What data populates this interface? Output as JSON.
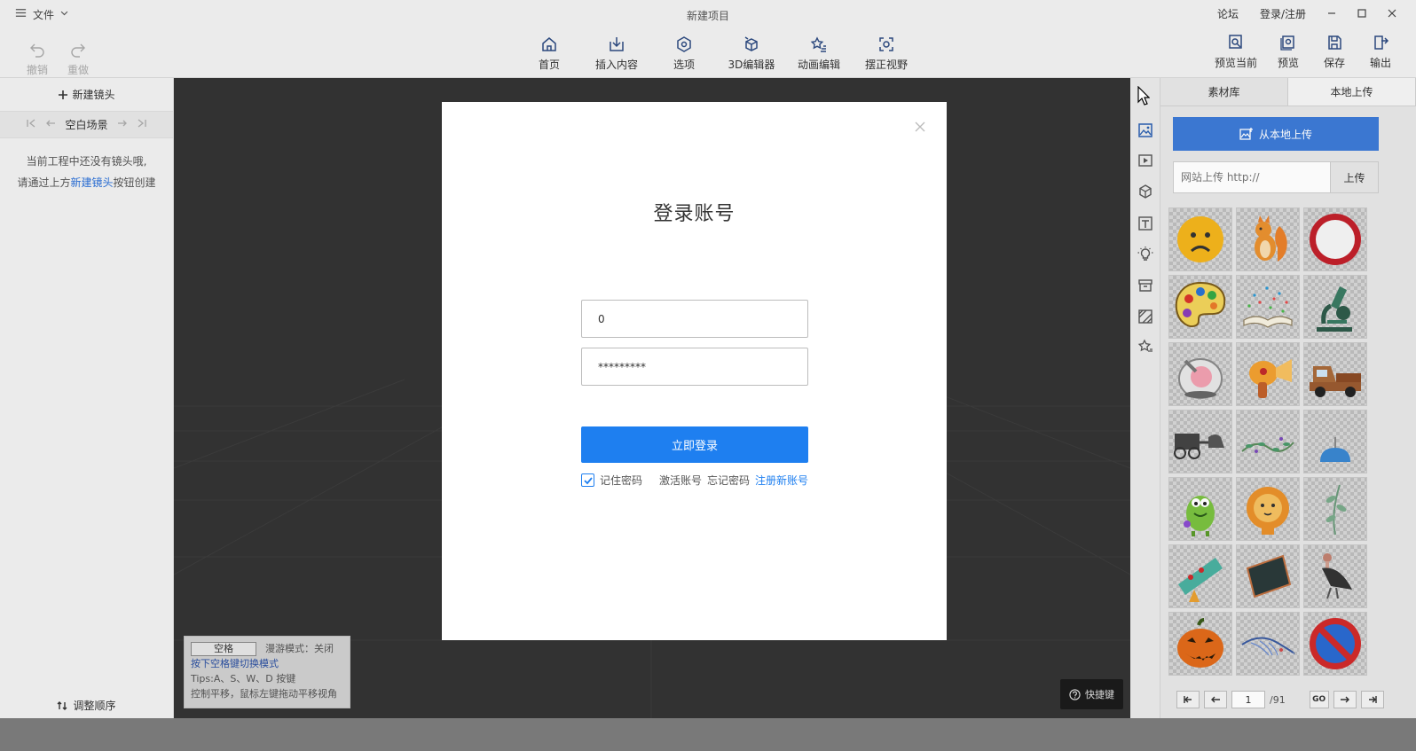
{
  "app": {
    "title": "新建项目",
    "file_menu": "文件",
    "forum": "论坛",
    "login_register": "登录/注册"
  },
  "toolbar": {
    "undo": "撤销",
    "redo": "重做",
    "center": [
      {
        "label": "首页",
        "icon": "home-icon"
      },
      {
        "label": "插入内容",
        "icon": "insert-icon"
      },
      {
        "label": "选项",
        "icon": "options-icon"
      },
      {
        "label": "3D编辑器",
        "icon": "cube-editor-icon"
      },
      {
        "label": "动画编辑",
        "icon": "animation-icon"
      },
      {
        "label": "摆正视野",
        "icon": "reset-view-icon"
      }
    ],
    "right": [
      {
        "label": "预览当前",
        "icon": "preview-current-icon"
      },
      {
        "label": "预览",
        "icon": "preview-icon"
      },
      {
        "label": "保存",
        "icon": "save-icon"
      },
      {
        "label": "输出",
        "icon": "export-icon"
      }
    ]
  },
  "left_panel": {
    "new_shot": "新建镜头",
    "scene_label": "空白场景",
    "empty_line1": "当前工程中还没有镜头哦,",
    "empty_line2_pre": "请通过上方",
    "empty_line2_link": "新建镜头",
    "empty_line2_post": "按钮创建",
    "reorder": "调整顺序"
  },
  "viewport": {
    "space_key": "空格",
    "roam_mode": "漫游模式：关闭",
    "hint_blue": "按下空格键切换模式",
    "tips_line1": "Tips:A、S、W、D 按键",
    "tips_line2": "控制平移，鼠标左键拖动平移视角",
    "shortcut": "快捷键"
  },
  "right_panel": {
    "tabs": [
      "素材库",
      "本地上传"
    ],
    "active_tab": 1,
    "upload_local": "从本地上传",
    "url_placeholder": "网站上传 http://",
    "url_button": "上传",
    "assets": [
      "sad-face-asset",
      "squirrel-asset",
      "no-entry-sign-asset",
      "paint-palette-asset",
      "open-book-asset",
      "microscope-asset",
      "glass-dome-asset",
      "ray-gun-asset",
      "pickup-truck-asset",
      "carriage-asset",
      "vine-branch-asset",
      "lamp-asset",
      "green-monster-asset",
      "lion-asset",
      "leaf-stem-asset",
      "telescope-asset",
      "chalkboard-asset",
      "vulture-asset",
      "pumpkin-asset",
      "feather-asset",
      "no-parking-sign-asset"
    ],
    "pager": {
      "page": "1",
      "total": "/91",
      "go": "GO"
    }
  },
  "modal": {
    "title": "登录账号",
    "username_value": "0",
    "password_value": "*********",
    "login_button": "立即登录",
    "remember": "记住密码",
    "remember_checked": true,
    "activate": "激活账号",
    "forgot": "忘记密码",
    "register": "注册新账号"
  },
  "colors": {
    "accent": "#1e7ff0",
    "upload_blue": "#3d7ad6"
  }
}
